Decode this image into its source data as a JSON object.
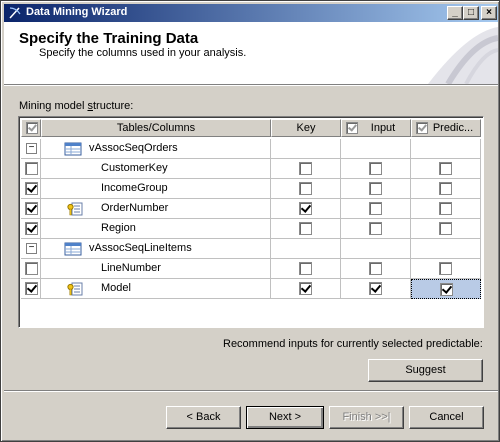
{
  "window": {
    "title": "Data Mining Wizard"
  },
  "header": {
    "title": "Specify the Training Data",
    "subtitle": "Specify the columns used in your analysis."
  },
  "structure_label": {
    "pre": "Mining model ",
    "accel": "s",
    "post": "tructure:"
  },
  "columns": {
    "tables": "Tables/Columns",
    "key": "Key",
    "input": "Input",
    "predictable": "Predic..."
  },
  "rows": [
    {
      "type": "table",
      "name": "vAssocSeqOrders",
      "key": false,
      "input": false,
      "predict": false
    },
    {
      "type": "column",
      "name": "CustomerKey",
      "include": false,
      "keyIcon": false,
      "key": false,
      "input": false,
      "predict": false
    },
    {
      "type": "column",
      "name": "IncomeGroup",
      "include": true,
      "keyIcon": false,
      "key": false,
      "input": false,
      "predict": false
    },
    {
      "type": "column",
      "name": "OrderNumber",
      "include": true,
      "keyIcon": true,
      "key": true,
      "input": false,
      "predict": false
    },
    {
      "type": "column",
      "name": "Region",
      "include": true,
      "keyIcon": false,
      "key": false,
      "input": false,
      "predict": false
    },
    {
      "type": "table",
      "name": "vAssocSeqLineItems",
      "key": false,
      "input": false,
      "predict": false
    },
    {
      "type": "column",
      "name": "LineNumber",
      "include": false,
      "keyIcon": false,
      "key": false,
      "input": false,
      "predict": false
    },
    {
      "type": "column",
      "name": "Model",
      "include": true,
      "keyIcon": true,
      "key": true,
      "input": true,
      "predict": true,
      "selected": true
    }
  ],
  "recommend_label": "Recommend inputs for currently selected predictable:",
  "buttons": {
    "suggest": "Suggest",
    "back": "< Back",
    "next": "Next >",
    "finish": "Finish >>|",
    "cancel": "Cancel"
  }
}
